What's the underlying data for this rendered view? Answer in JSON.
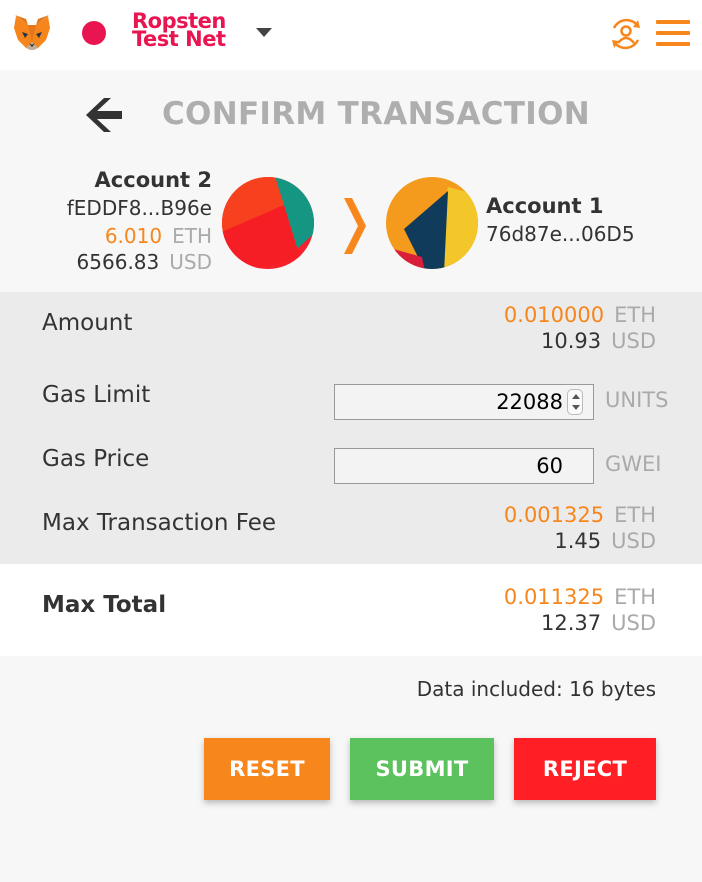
{
  "network": {
    "name": "Ropsten Test Net",
    "dot_color": "#e91550"
  },
  "header": {
    "title": "CONFIRM TRANSACTION"
  },
  "from_account": {
    "name": "Account 2",
    "address": "fEDDF8...B96e",
    "eth_balance": "6.010",
    "eth_unit": "ETH",
    "usd_balance": "6566.83",
    "usd_unit": "USD"
  },
  "to_account": {
    "name": "Account 1",
    "address": "76d87e...06D5"
  },
  "details": {
    "amount": {
      "label": "Amount",
      "eth": "0.010000",
      "eth_unit": "ETH",
      "usd": "10.93",
      "usd_unit": "USD"
    },
    "gas_limit": {
      "label": "Gas Limit",
      "value": "22088",
      "unit": "UNITS"
    },
    "gas_price": {
      "label": "Gas Price",
      "value": "60",
      "unit": "GWEI"
    },
    "max_fee": {
      "label": "Max Transaction Fee",
      "eth": "0.001325",
      "eth_unit": "ETH",
      "usd": "1.45",
      "usd_unit": "USD"
    }
  },
  "total": {
    "label": "Max Total",
    "eth": "0.011325",
    "eth_unit": "ETH",
    "usd": "12.37",
    "usd_unit": "USD"
  },
  "data_included": "Data included: 16 bytes",
  "buttons": {
    "reset": "RESET",
    "submit": "SUBMIT",
    "reject": "REJECT"
  },
  "colors": {
    "accent": "#f7861c",
    "submit": "#5cc25e",
    "reject": "#ff1f24",
    "network": "#e91550"
  },
  "icons": {
    "logo": "metamask-fox-icon",
    "account_menu": "account-switch-icon",
    "menu": "hamburger-menu-icon",
    "back": "back-arrow-icon",
    "direction": "chevron-right-icon"
  }
}
